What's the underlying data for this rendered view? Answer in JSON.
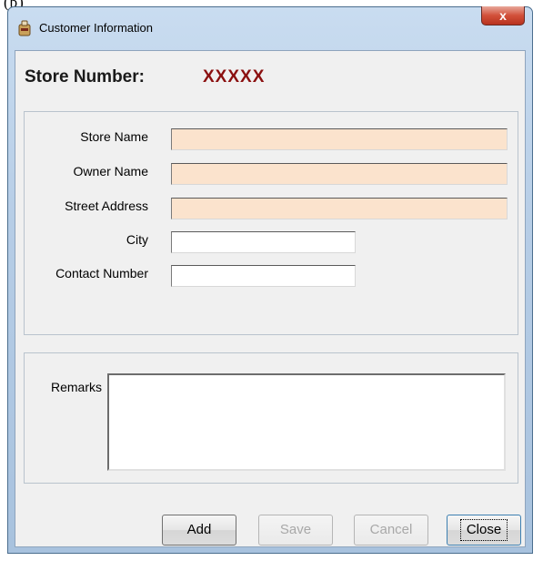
{
  "caption_fragment": "(b)",
  "window": {
    "title": "Customer Information",
    "close_glyph": "x"
  },
  "store": {
    "label": "Store Number:",
    "value": "XXXXX"
  },
  "fields": {
    "store_name": {
      "label": "Store Name",
      "value": ""
    },
    "owner_name": {
      "label": "Owner Name",
      "value": ""
    },
    "street_address": {
      "label": "Street Address",
      "value": ""
    },
    "city": {
      "label": "City",
      "value": ""
    },
    "contact_number": {
      "label": "Contact Number",
      "value": ""
    }
  },
  "remarks": {
    "label": "Remarks",
    "value": ""
  },
  "buttons": {
    "add": "Add",
    "save": "Save",
    "cancel": "Cancel",
    "close": "Close"
  },
  "colors": {
    "required_field": "#fbe3cd",
    "store_value": "#8b1010",
    "close_button": "#c8412c"
  },
  "icons": {
    "app": "app-icon",
    "close": "close-icon"
  }
}
